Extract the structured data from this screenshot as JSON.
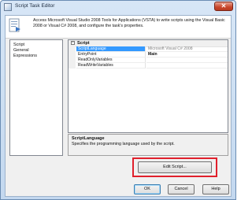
{
  "window": {
    "title": "Script Task Editor",
    "close_glyph": "✕"
  },
  "header": {
    "description": "Access Microsoft Visual Studio 2008 Tools for Applications (VSTA) to write scripts using the Visual Basic 2008 or Visual C# 2008, and configure the task's properties."
  },
  "sidebar": {
    "items": [
      {
        "label": "Script"
      },
      {
        "label": "General"
      },
      {
        "label": "Expressions"
      }
    ]
  },
  "properties": {
    "category": "Script",
    "category_toggle": "−",
    "rows": [
      {
        "name": "ScriptLanguage",
        "value": "Microsoft Visual C# 2008"
      },
      {
        "name": "EntryPoint",
        "value": "Main"
      },
      {
        "name": "ReadOnlyVariables",
        "value": ""
      },
      {
        "name": "ReadWriteVariables",
        "value": ""
      }
    ]
  },
  "description_box": {
    "title": "ScriptLanguage",
    "text": "Specifies the programming language used by the script."
  },
  "buttons": {
    "edit_script": "Edit Script...",
    "ok": "OK",
    "cancel": "Cancel",
    "help": "Help"
  },
  "colors": {
    "selection": "#3399ff",
    "highlight_box": "#e0202c",
    "titlebar": "#c3d8ef"
  },
  "icons": {
    "window": "script-task-icon",
    "header": "script-document-icon",
    "close": "close-icon"
  }
}
